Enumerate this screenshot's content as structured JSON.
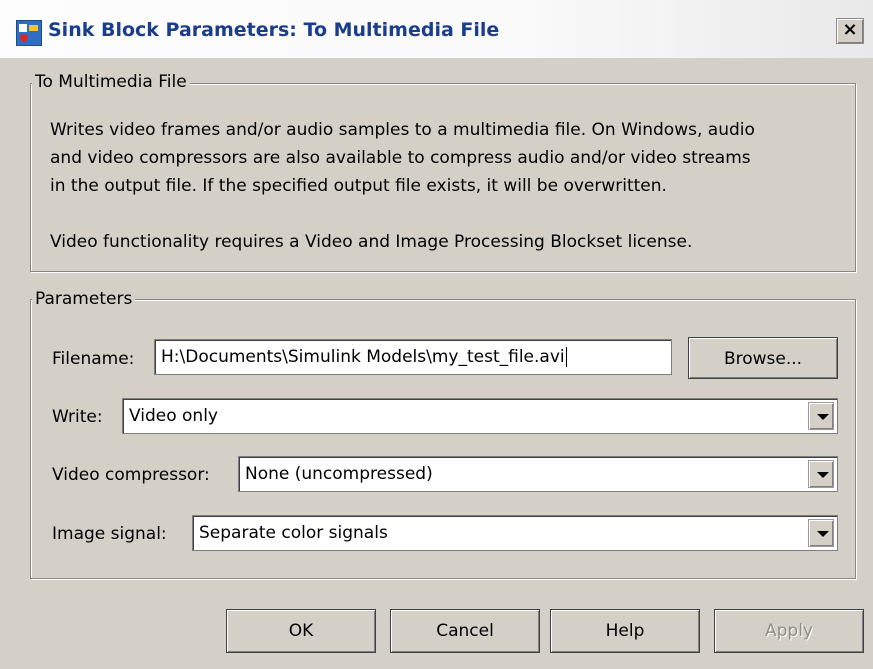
{
  "window": {
    "title": "Sink Block Parameters: To Multimedia File",
    "close_label": "×"
  },
  "description_group": {
    "legend": "To Multimedia File",
    "paragraph1_line1": "Writes video frames and/or audio samples to a multimedia file. On Windows, audio",
    "paragraph1_line2": "and video compressors are also available to compress audio and/or video streams",
    "paragraph1_line3": "in the output file. If the specified output file exists, it will be overwritten.",
    "paragraph2": "Video functionality requires a Video and Image Processing Blockset license."
  },
  "parameters_group": {
    "legend": "Parameters",
    "filename": {
      "label": "Filename:",
      "value": "H:\\Documents\\Simulink Models\\my_test_file.avi"
    },
    "browse_label": "Browse...",
    "write": {
      "label": "Write:",
      "value": "Video only"
    },
    "video_compressor": {
      "label": "Video compressor:",
      "value": "None (uncompressed)"
    },
    "image_signal": {
      "label": "Image signal:",
      "value": "Separate color signals"
    }
  },
  "buttons": {
    "ok": "OK",
    "cancel": "Cancel",
    "help": "Help",
    "apply": "Apply"
  }
}
